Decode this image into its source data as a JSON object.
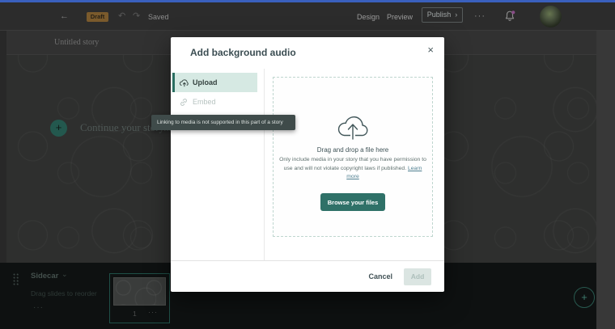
{
  "icons": {
    "back": "←",
    "undo": "↶",
    "redo": "↷",
    "more": "···",
    "publish_chevron": "›",
    "close": "×",
    "plus": "+",
    "chevron_down": "⌄",
    "ellipsis": "···"
  },
  "header": {
    "draft_badge": "Draft",
    "saved_label": "Saved",
    "design_label": "Design",
    "preview_label": "Preview",
    "publish_label": "Publish"
  },
  "editor": {
    "title": "Untitled story",
    "placeholder": "Continue your story..."
  },
  "modal": {
    "title": "Add background audio",
    "tabs": [
      {
        "label": "Upload"
      },
      {
        "label": "Embed"
      }
    ],
    "tooltip": "Linking to media is not supported in this part of a story",
    "dropzone": {
      "heading": "Drag and drop a file here",
      "note": "Only include media in your story that you have permission to use and will not violate copyright laws if published.",
      "link_label": "Learn more",
      "browse_label": "Browse your files"
    },
    "footer": {
      "cancel_label": "Cancel",
      "add_label": "Add"
    }
  },
  "sidecar": {
    "label": "Sidecar",
    "hint": "Drag slides to reorder",
    "slide_number": "1"
  },
  "colors": {
    "accent_teal": "#2f7168",
    "tab_active_bg": "#d6e9e3",
    "draft_badge_bg": "#7a5a2c",
    "top_bar_blue": "#3a60bd",
    "notification_dot": "#8a4c88",
    "add_disabled_bg": "#dbe5e2"
  }
}
